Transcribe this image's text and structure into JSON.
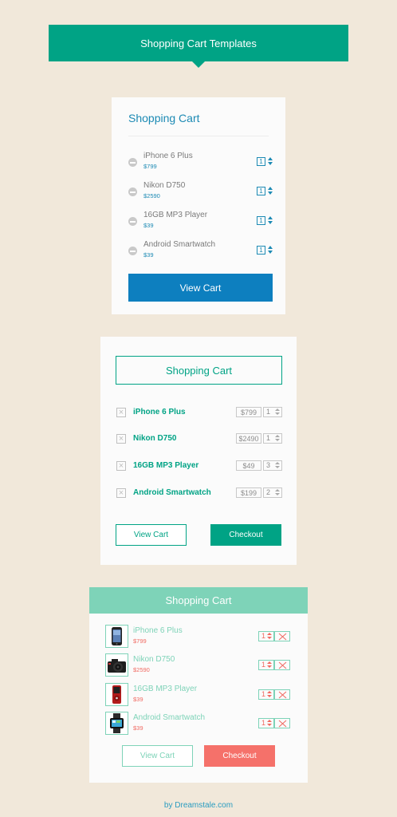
{
  "banner": {
    "title": "Shopping Cart Templates"
  },
  "card1": {
    "title": "Shopping Cart",
    "items": [
      {
        "name": "iPhone 6 Plus",
        "price": "$799",
        "qty": "1"
      },
      {
        "name": "Nikon D750",
        "price": "$2590",
        "qty": "1"
      },
      {
        "name": "16GB MP3 Player",
        "price": "$39",
        "qty": "1"
      },
      {
        "name": "Android Smartwatch",
        "price": "$39",
        "qty": "1"
      }
    ],
    "view_cart": "View Cart"
  },
  "card2": {
    "title": "Shopping Cart",
    "items": [
      {
        "name": "iPhone 6 Plus",
        "price": "$799",
        "qty": "1"
      },
      {
        "name": "Nikon D750",
        "price": "$2490",
        "qty": "1"
      },
      {
        "name": "16GB MP3 Player",
        "price": "$49",
        "qty": "3"
      },
      {
        "name": "Android Smartwatch",
        "price": "$199",
        "qty": "2"
      }
    ],
    "view_cart": "View Cart",
    "checkout": "Checkout"
  },
  "card3": {
    "title": "Shopping Cart",
    "items": [
      {
        "name": "iPhone 6 Plus",
        "price": "$799",
        "qty": "1",
        "icon": "iphone-icon"
      },
      {
        "name": "Nikon D750",
        "price": "$2590",
        "qty": "1",
        "icon": "camera-icon"
      },
      {
        "name": "16GB MP3 Player",
        "price": "$39",
        "qty": "1",
        "icon": "mp3-player-icon"
      },
      {
        "name": "Android Smartwatch",
        "price": "$39",
        "qty": "1",
        "icon": "smartwatch-icon"
      }
    ],
    "view_cart": "View Cart",
    "checkout": "Checkout"
  },
  "footer": {
    "credit": "by Dreamstale.com"
  },
  "colors": {
    "background": "#f1e8da",
    "teal": "#00a385",
    "blue": "#0d7fbf",
    "mint": "#7ed3b8",
    "coral": "#f5716a"
  }
}
